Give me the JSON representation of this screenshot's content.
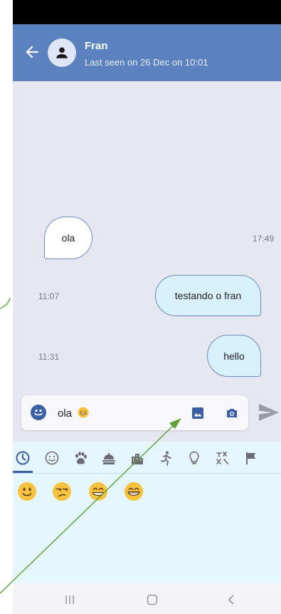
{
  "contact": {
    "name": "Fran",
    "last_seen": "Last seen on 26 Dec on 10:01"
  },
  "messages": [
    {
      "text": "ola",
      "time": "17:49",
      "direction": "incoming"
    },
    {
      "text": "testando o fran",
      "time": "11:07",
      "direction": "outgoing"
    },
    {
      "text": "hello",
      "time": "11:31",
      "direction": "outgoing"
    }
  ],
  "composer": {
    "text": "ola",
    "emoji_icon": "grinning-face-icon",
    "icons": [
      "emoji-icon",
      "image-icon",
      "camera-icon",
      "send-icon"
    ]
  },
  "emoji_picker": {
    "categories": [
      "recent-icon",
      "smileys-icon",
      "animals-icon",
      "food-icon",
      "travel-icon",
      "activities-icon",
      "objects-icon",
      "symbols-icon",
      "flags-icon"
    ],
    "selected_category": "recent-icon",
    "recent_emojis": [
      "slightly-smiling-face",
      "unamused-face",
      "grinning-face-with-smiling-eyes",
      "grinning-face"
    ]
  },
  "colors": {
    "appbar": "#5a82bf",
    "chat_bg": "#e7e7f2",
    "outgoing_bubble": "#d8f1fc",
    "incoming_bubble": "#ffffff",
    "accent": "#3c5fa6",
    "annotation_arrow": "#5ca03a"
  }
}
